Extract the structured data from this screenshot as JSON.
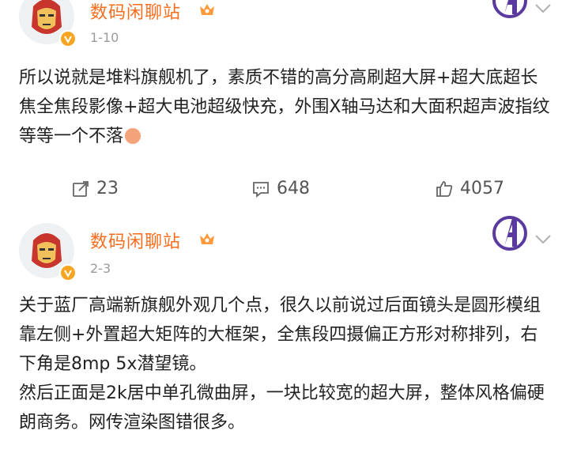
{
  "posts": [
    {
      "author": "数码闲聊站",
      "date": "1-10",
      "text": [
        "所以说就是堆料旗舰机了，素质不错的高分高刷超大屏+超大底超长焦全焦段影像+超大电池超级快充，外围X轴马达和大面积超声波指纹等等一个不落"
      ],
      "emoji": "face-emoji",
      "stats": {
        "repost": "23",
        "comment": "648",
        "like": "4057"
      }
    },
    {
      "author": "数码闲聊站",
      "date": "2-3",
      "text": [
        "关于蓝厂高端新旗舰外观几个点，很久以前说过后面镜头是圆形模组靠左侧+外置超大矩阵的大框架，全焦段四摄偏正方形对称排列，右下角是8mp 5x潜望镜。",
        "然后正面是2k居中单孔微曲屏，一块比较宽的超大屏，整体风格偏硬朗商务。网传渲染图错很多。"
      ]
    }
  ],
  "colors": {
    "name": "#f86d1d",
    "badge": "#f6a623",
    "text": "#222222",
    "muted": "#9a9a9a"
  },
  "icons": [
    "avatar-ironman",
    "verified-badge-icon",
    "crown-icon",
    "avengers-logo-icon",
    "chevron-down-icon",
    "repost-icon",
    "comment-icon",
    "like-icon"
  ]
}
